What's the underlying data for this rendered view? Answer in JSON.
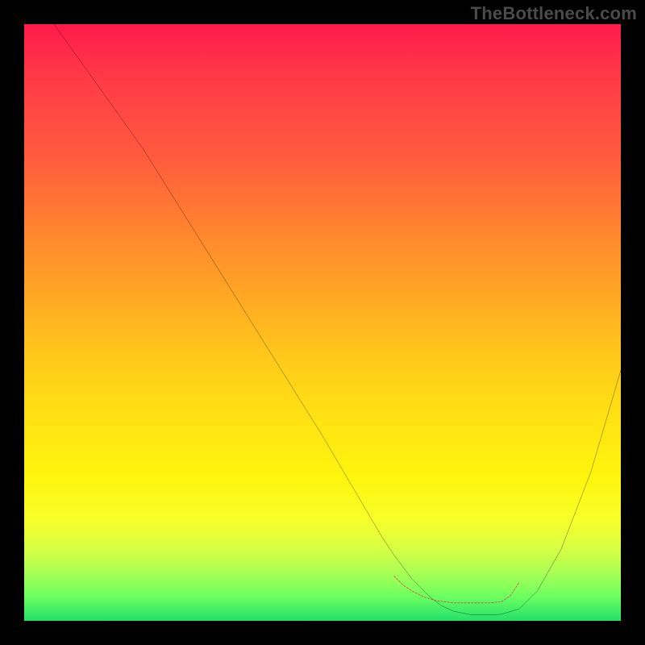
{
  "watermark": "TheBottleneck.com",
  "chart_data": {
    "type": "line",
    "title": "",
    "xlabel": "",
    "ylabel": "",
    "xlim": [
      0,
      100
    ],
    "ylim": [
      0,
      100
    ],
    "gradient_stops": [
      {
        "pos": 0,
        "color": "#ff1a4b"
      },
      {
        "pos": 9,
        "color": "#ff3a48"
      },
      {
        "pos": 22,
        "color": "#ff5a3e"
      },
      {
        "pos": 34,
        "color": "#ff8330"
      },
      {
        "pos": 45,
        "color": "#ffa624"
      },
      {
        "pos": 56,
        "color": "#ffc91a"
      },
      {
        "pos": 66,
        "color": "#ffe213"
      },
      {
        "pos": 76,
        "color": "#fff50d"
      },
      {
        "pos": 83,
        "color": "#f8ff2a"
      },
      {
        "pos": 88,
        "color": "#d6ff44"
      },
      {
        "pos": 92,
        "color": "#a8ff55"
      },
      {
        "pos": 96,
        "color": "#6bff60"
      },
      {
        "pos": 100,
        "color": "#22e06a"
      }
    ],
    "series": [
      {
        "name": "bottleneck-curve",
        "color": "#000000",
        "width": 2.2,
        "x": [
          5,
          10,
          15,
          20,
          25,
          30,
          35,
          40,
          45,
          50,
          55,
          60,
          62,
          65,
          68,
          70,
          72,
          75,
          78,
          80,
          83,
          86,
          90,
          95,
          100
        ],
        "y": [
          100,
          93,
          86,
          79,
          71,
          63,
          55,
          47,
          39,
          31,
          22.5,
          14,
          11,
          7,
          4,
          2.5,
          1.6,
          1,
          1,
          1.1,
          2,
          5,
          12,
          25,
          42
        ]
      },
      {
        "name": "optimal-marker",
        "color": "#d24a4a",
        "width": 6,
        "x": [
          62,
          63.5,
          65,
          67,
          69,
          70.5,
          72,
          73.5,
          75,
          76.5,
          78,
          80,
          81.5,
          83
        ],
        "y": [
          7.5,
          6.0,
          5.0,
          4.0,
          3.4,
          3.2,
          3.0,
          3.0,
          3.0,
          3.0,
          3.0,
          3.2,
          4.2,
          6.5
        ],
        "dashed": true
      }
    ]
  }
}
